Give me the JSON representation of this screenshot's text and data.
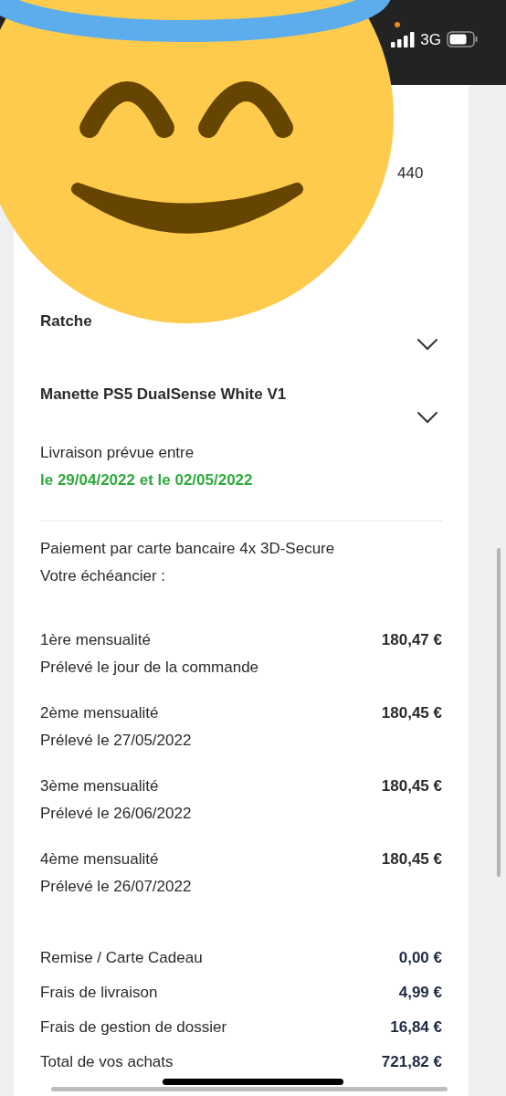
{
  "status_bar": {
    "network": "3G"
  },
  "address_fragment": "440",
  "products": [
    {
      "name": "Ratche",
      "expanded": false
    },
    {
      "name": "Manette PS5 DualSense White V1",
      "expanded": false
    }
  ],
  "delivery": {
    "label": "Livraison prévue entre",
    "dates": "le 29/04/2022 et le 02/05/2022"
  },
  "payment": {
    "method": "Paiement par carte bancaire 4x 3D-Secure",
    "schedule_label": "Votre échéancier :",
    "installments": [
      {
        "title": "1ère mensualité",
        "amount": "180,47 €",
        "date": "Prélevé le jour de la commande"
      },
      {
        "title": "2ème mensualité",
        "amount": "180,45 €",
        "date": "Prélevé le 27/05/2022"
      },
      {
        "title": "3ème mensualité",
        "amount": "180,45 €",
        "date": "Prélevé le 26/06/2022"
      },
      {
        "title": "4ème mensualité",
        "amount": "180,45 €",
        "date": "Prélevé le 26/07/2022"
      }
    ]
  },
  "summary": [
    {
      "label": "Remise / Carte Cadeau",
      "value": "0,00 €"
    },
    {
      "label": "Frais de livraison",
      "value": "4,99 €"
    },
    {
      "label": "Frais de gestion de dossier",
      "value": "16,84 €"
    },
    {
      "label": "Total de vos achats",
      "value": "721,82 €"
    }
  ]
}
